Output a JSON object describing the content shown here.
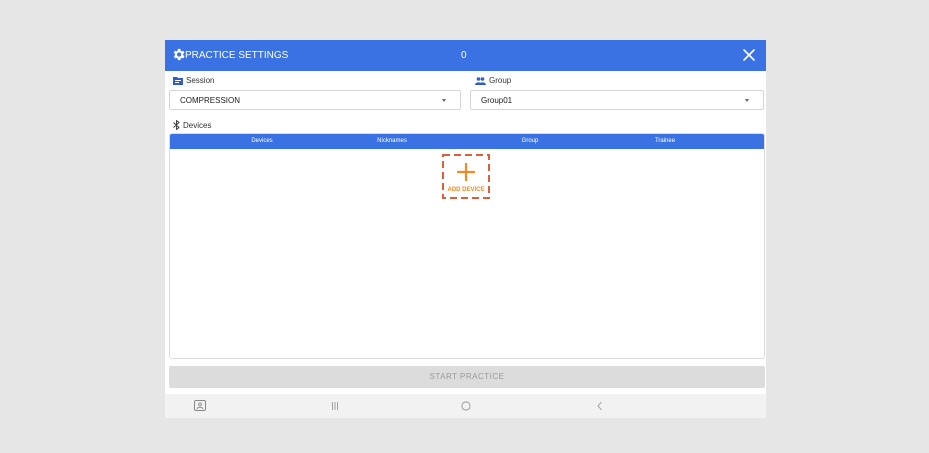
{
  "header": {
    "title": "PRACTICE SETTINGS",
    "count": "0",
    "accent_color": "#3b72e3",
    "settings_icon": "gear-icon",
    "close_icon": "close-icon"
  },
  "session": {
    "label": "Session",
    "icon": "folder-icon",
    "value": "COMPRESSION"
  },
  "group": {
    "label": "Group",
    "icon": "people-icon",
    "value": "Group01"
  },
  "devices": {
    "label": "Devices",
    "icon": "bluetooth-icon",
    "columns": [
      "Devices",
      "Nicknames",
      "Group",
      "Trainee"
    ],
    "rows": [],
    "add_label": "ADD DEVICE",
    "add_color": "#f08a24"
  },
  "start_button": {
    "label": "START PRACTICE",
    "enabled": false
  },
  "navbar": {
    "items": [
      "screen-icon",
      "recent-apps-icon",
      "home-icon",
      "back-icon"
    ]
  }
}
